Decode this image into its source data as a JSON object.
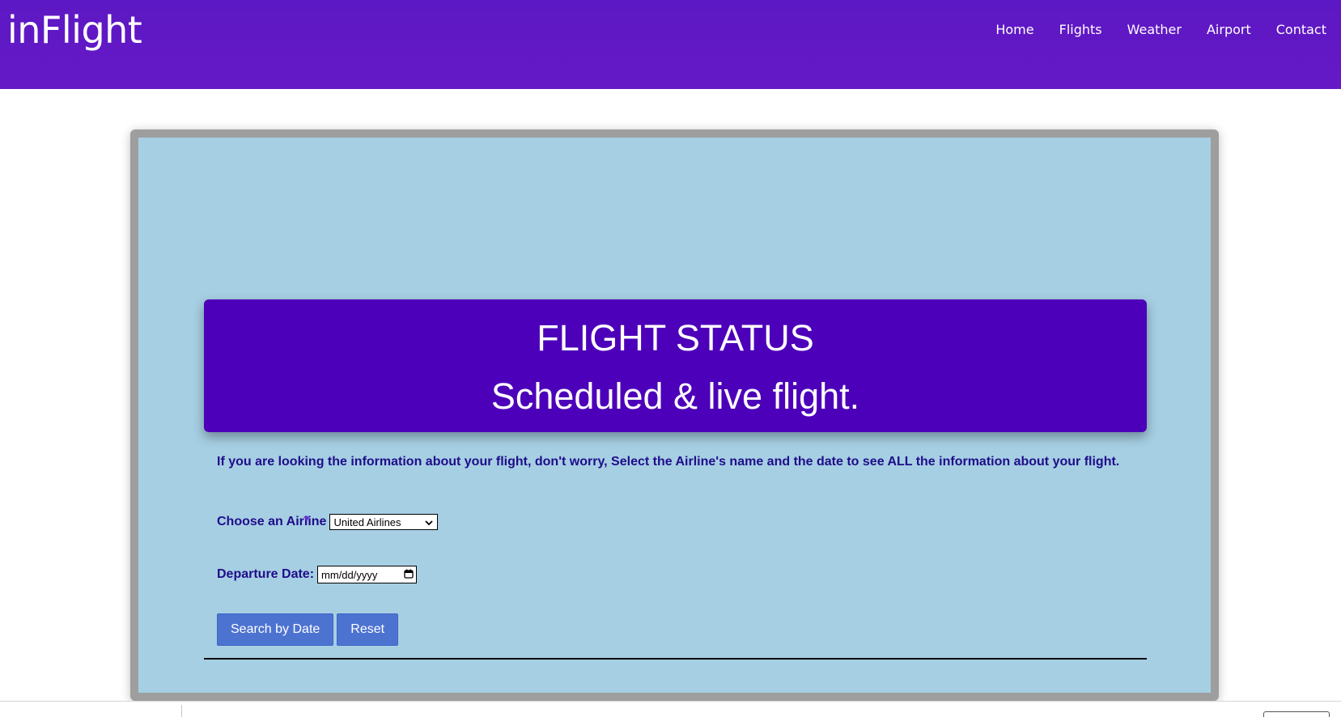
{
  "header": {
    "logo": "inFlight",
    "nav": [
      "Home",
      "Flights",
      "Weather",
      "Airport",
      "Contact"
    ]
  },
  "banner": {
    "title": "FLIGHT STATUS",
    "subtitle": "Scheduled & live flight."
  },
  "intro_text": "If you are looking the information about your flight, don't worry, Select the Airline's name and the date to see ALL the information about your flight.",
  "form": {
    "airline_label": "Choose an Airline",
    "airline_selected": "United Airlines",
    "date_label": "Departure Date:",
    "date_placeholder": "mm/dd/yyyy",
    "search_button": "Search by Date",
    "reset_button": "Reset"
  },
  "icons": {
    "dropdown": "chevron-down-icon",
    "calendar": "calendar-icon"
  },
  "colors": {
    "header": "#5c18c4",
    "frame_bg": "#a6cfe3",
    "frame_border": "#9e9e9e",
    "banner": "#4d00b9",
    "text": "#1f0d8a",
    "button": "#4d73d1"
  }
}
